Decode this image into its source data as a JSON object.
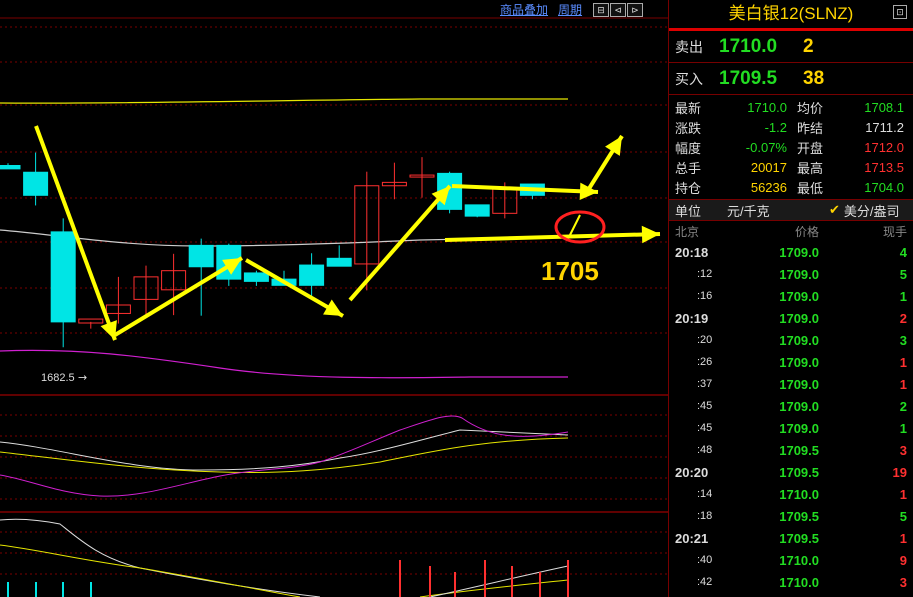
{
  "toolbar": {
    "overlay_label": "商品叠加",
    "period_label": "周期",
    "buttons": [
      "⊟",
      "⊲",
      "⊳"
    ]
  },
  "annotations": {
    "low_label": "1682.5",
    "level_label": "1705"
  },
  "panel": {
    "title": "美白银12(SLNZ)",
    "corner_icon": "restore",
    "sell": {
      "label": "卖出",
      "price": "1710.0",
      "volume": "2"
    },
    "buy": {
      "label": "买入",
      "price": "1709.5",
      "volume": "38"
    },
    "stats": [
      {
        "k1": "最新",
        "v1": "1710.0",
        "c1": "green",
        "k2": "均价",
        "v2": "1708.1",
        "c2": "green"
      },
      {
        "k1": "涨跌",
        "v1": "-1.2",
        "c1": "green",
        "k2": "昨结",
        "v2": "1711.2",
        "c2": "white"
      },
      {
        "k1": "幅度",
        "v1": "-0.07%",
        "c1": "green",
        "k2": "开盘",
        "v2": "1712.0",
        "c2": "red"
      },
      {
        "k1": "总手",
        "v1": "20017",
        "c1": "yellow",
        "k2": "最高",
        "v2": "1713.5",
        "c2": "red"
      },
      {
        "k1": "持仓",
        "v1": "56236",
        "c1": "yellow",
        "k2": "最低",
        "v2": "1704.0",
        "c2": "green"
      }
    ],
    "unit": {
      "label": "单位",
      "value": "元/千克",
      "option": "美分/盎司"
    },
    "table_header": {
      "time": "北京",
      "price": "价格",
      "qty": "现手"
    },
    "trades": [
      {
        "time": "20:18",
        "sub": false,
        "price": "1709.0",
        "qty": "4",
        "color": "green"
      },
      {
        "time": ":12",
        "sub": true,
        "price": "1709.0",
        "qty": "5",
        "color": "green"
      },
      {
        "time": ":16",
        "sub": true,
        "price": "1709.0",
        "qty": "1",
        "color": "green"
      },
      {
        "time": "20:19",
        "sub": false,
        "price": "1709.0",
        "qty": "2",
        "color": "red"
      },
      {
        "time": ":20",
        "sub": true,
        "price": "1709.0",
        "qty": "3",
        "color": "green"
      },
      {
        "time": ":26",
        "sub": true,
        "price": "1709.0",
        "qty": "1",
        "color": "red"
      },
      {
        "time": ":37",
        "sub": true,
        "price": "1709.0",
        "qty": "1",
        "color": "red"
      },
      {
        "time": ":45",
        "sub": true,
        "price": "1709.0",
        "qty": "2",
        "color": "green"
      },
      {
        "time": ":45",
        "sub": true,
        "price": "1709.0",
        "qty": "1",
        "color": "green"
      },
      {
        "time": ":48",
        "sub": true,
        "price": "1709.5",
        "qty": "3",
        "color": "red"
      },
      {
        "time": "20:20",
        "sub": false,
        "price": "1709.5",
        "qty": "19",
        "color": "red"
      },
      {
        "time": ":14",
        "sub": true,
        "price": "1710.0",
        "qty": "1",
        "color": "red"
      },
      {
        "time": ":18",
        "sub": true,
        "price": "1709.5",
        "qty": "5",
        "color": "green"
      },
      {
        "time": "20:21",
        "sub": false,
        "price": "1709.5",
        "qty": "1",
        "color": "red"
      },
      {
        "time": ":40",
        "sub": true,
        "price": "1710.0",
        "qty": "9",
        "color": "red"
      },
      {
        "time": ":42",
        "sub": true,
        "price": "1710.0",
        "qty": "3",
        "color": "red"
      }
    ],
    "colors": {
      "up": "#ff3030",
      "down": "#22dd22",
      "accent": "#ffd400"
    }
  },
  "chart_data": {
    "type": "candlestick",
    "candles": [
      {
        "o": 1714.8,
        "h": 1715.2,
        "l": 1714.4,
        "c": 1714.2
      },
      {
        "o": 1713.6,
        "h": 1717.1,
        "l": 1707.7,
        "c": 1709.5
      },
      {
        "o": 1703.0,
        "h": 1705.4,
        "l": 1682.5,
        "c": 1687.0
      },
      {
        "o": 1686.8,
        "h": 1687.0,
        "l": 1685.8,
        "c": 1687.5
      },
      {
        "o": 1688.5,
        "h": 1695.0,
        "l": 1686.7,
        "c": 1690.0
      },
      {
        "o": 1691.0,
        "h": 1697.0,
        "l": 1688.0,
        "c": 1695.0
      },
      {
        "o": 1692.7,
        "h": 1699.1,
        "l": 1688.2,
        "c": 1696.1
      },
      {
        "o": 1700.6,
        "h": 1701.8,
        "l": 1688.1,
        "c": 1696.8
      },
      {
        "o": 1700.6,
        "h": 1700.9,
        "l": 1693.4,
        "c": 1694.6
      },
      {
        "o": 1695.7,
        "h": 1696.1,
        "l": 1693.4,
        "c": 1694.2
      },
      {
        "o": 1694.6,
        "h": 1696.1,
        "l": 1693.5,
        "c": 1693.5
      },
      {
        "o": 1697.1,
        "h": 1699.2,
        "l": 1691.5,
        "c": 1693.5
      },
      {
        "o": 1698.3,
        "h": 1700.6,
        "l": 1696.9,
        "c": 1696.9
      },
      {
        "o": 1697.3,
        "h": 1713.7,
        "l": 1692.6,
        "c": 1711.2
      },
      {
        "o": 1711.2,
        "h": 1715.3,
        "l": 1708.8,
        "c": 1711.8
      },
      {
        "o": 1713.1,
        "h": 1716.3,
        "l": 1709.1,
        "c": 1713.1
      },
      {
        "o": 1713.4,
        "h": 1713.7,
        "l": 1706.3,
        "c": 1707.0
      },
      {
        "o": 1707.8,
        "h": 1707.8,
        "l": 1705.6,
        "c": 1705.8
      },
      {
        "o": 1706.3,
        "h": 1711.8,
        "l": 1705.4,
        "c": 1710.8
      },
      {
        "o": 1711.5,
        "h": 1711.5,
        "l": 1708.8,
        "c": 1709.5
      }
    ],
    "annotations": [
      "1682.5",
      "1705"
    ]
  }
}
